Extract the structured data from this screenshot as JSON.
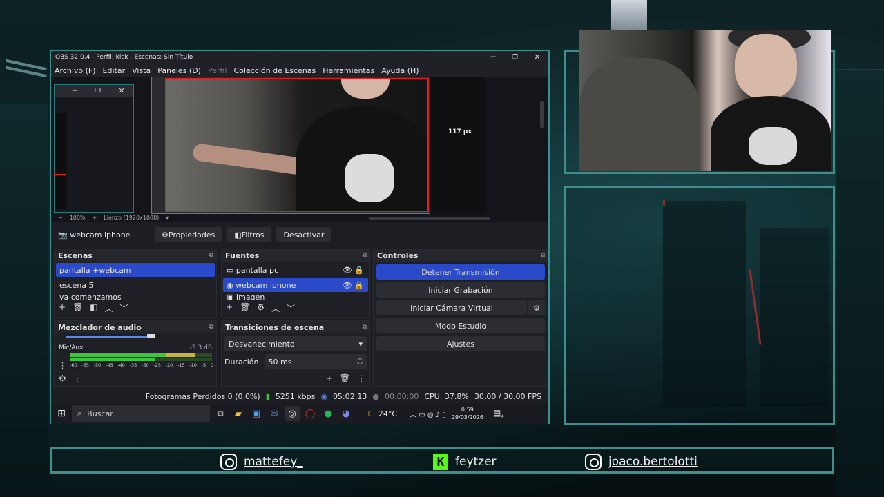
{
  "window": {
    "title": "OBS 32.0.4 - Perfil: kick - Escenas: Sin Título",
    "minimize": "─",
    "maximize": "❐",
    "close": "✕"
  },
  "menu": [
    "Archivo (F)",
    "Editar",
    "Vista",
    "Paneles (D)",
    "Perfil",
    "Colección de Escenas",
    "Herramientas",
    "Ayuda (H)"
  ],
  "preview": {
    "measure_label": "117 px",
    "zoom": "100%",
    "canvas": "Lienzo (1920x1080)",
    "minus": "−",
    "plus": "+"
  },
  "source_toolbar": {
    "source_name": "webcam iphone",
    "properties": "Propiedades",
    "filters": "Filtros",
    "deactivate": "Desactivar"
  },
  "scenes": {
    "title": "Escenas",
    "items": [
      "pantalla +webcam",
      "escena 5",
      "ya comenzamos"
    ]
  },
  "sources": {
    "title": "Fuentes",
    "items": [
      "pantalla pc",
      "webcam iphone",
      "Imagen"
    ]
  },
  "controls": {
    "title": "Controles",
    "stop_stream": "Detener Transmisión",
    "start_record": "Iniciar Grabación",
    "start_virtual_cam": "Iniciar Cámara Virtual",
    "studio_mode": "Modo Estudio",
    "settings": "Ajustes"
  },
  "audio_mixer": {
    "title": "Mezclador de audio",
    "channel": "Mic/Aux",
    "level": "-5.3 dB",
    "ticks": [
      "-60",
      "-55",
      "-50",
      "-45",
      "-40",
      "-35",
      "-30",
      "-25",
      "-20",
      "-15",
      "-10",
      "-5",
      "0"
    ]
  },
  "transitions": {
    "title": "Transiciones de escena",
    "selected": "Desvanecimiento",
    "duration_label": "Duración",
    "duration_value": "50 ms"
  },
  "status": {
    "dropped_frames": "Fotogramas Perdidos 0 (0.0%)",
    "bitrate": "5251 kbps",
    "stream_time": "05:02:13",
    "record_time": "00:00:00",
    "cpu": "CPU: 37.8%",
    "fps": "30.00 / 30.00 FPS"
  },
  "taskbar": {
    "search": "Buscar",
    "weather": "24°C",
    "time": "0:59",
    "date": "29/03/2026",
    "notifications": "4"
  },
  "social": {
    "instagram_1": "mattefey_",
    "kick": "feytzer",
    "instagram_2": "joaco.bertolotti"
  },
  "colors": {
    "accent_frame": "#3d8f8d",
    "selection_blue": "#2b4ac9",
    "kick_green": "#53fc18",
    "bounding_red": "#e02020"
  }
}
